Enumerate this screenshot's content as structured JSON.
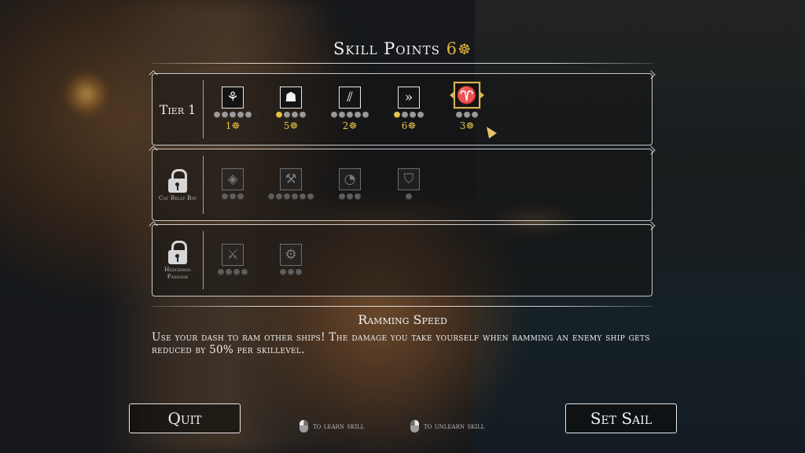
{
  "header": {
    "title": "Skill Points",
    "points": "6",
    "currency_icon": "ship-wheel-icon"
  },
  "tiers": [
    {
      "label": "Tier 1",
      "locked": false,
      "skills": [
        {
          "icon": "crew-bag-icon",
          "glyph": "⚘",
          "level": 0,
          "max": 5,
          "cost": "1",
          "state": "available"
        },
        {
          "icon": "captain-hat-icon",
          "glyph": "☗",
          "level": 1,
          "max": 4,
          "cost": "5",
          "state": "available"
        },
        {
          "icon": "claw-marks-icon",
          "glyph": "⫽",
          "level": 0,
          "max": 5,
          "cost": "2",
          "state": "available"
        },
        {
          "icon": "dash-arrows-icon",
          "glyph": "»",
          "level": 1,
          "max": 4,
          "cost": "6",
          "state": "available"
        },
        {
          "icon": "ram-head-icon",
          "glyph": "♈",
          "level": 0,
          "max": 3,
          "cost": "3",
          "state": "selected"
        }
      ]
    },
    {
      "label": "Cat Belly Bay",
      "locked": true,
      "skills": [
        {
          "icon": "bomb-pot-icon",
          "glyph": "◈",
          "max": 3
        },
        {
          "icon": "hammer-crossed-icon",
          "glyph": "⚒",
          "max": 6
        },
        {
          "icon": "speed-gauge-icon",
          "glyph": "◔",
          "max": 3
        },
        {
          "icon": "shield-banner-icon",
          "glyph": "⛉",
          "max": 1
        }
      ]
    },
    {
      "label": "Hedgehog Passage",
      "locked": true,
      "skills": [
        {
          "icon": "crossed-swords-icon",
          "glyph": "⚔",
          "max": 4
        },
        {
          "icon": "cogwheel-hammer-icon",
          "glyph": "⚙",
          "max": 3
        }
      ]
    }
  ],
  "detail": {
    "title": "Ramming Speed",
    "description": "Use your dash to ram other ships! The damage you take yourself when ramming an enemy ship gets reduced by 50% per skillevel."
  },
  "buttons": {
    "quit": "Quit",
    "set_sail": "Set Sail"
  },
  "hints": {
    "learn": "to learn skill",
    "unlearn": "to unlearn skill"
  },
  "colors": {
    "accent": "#e6c24a"
  }
}
